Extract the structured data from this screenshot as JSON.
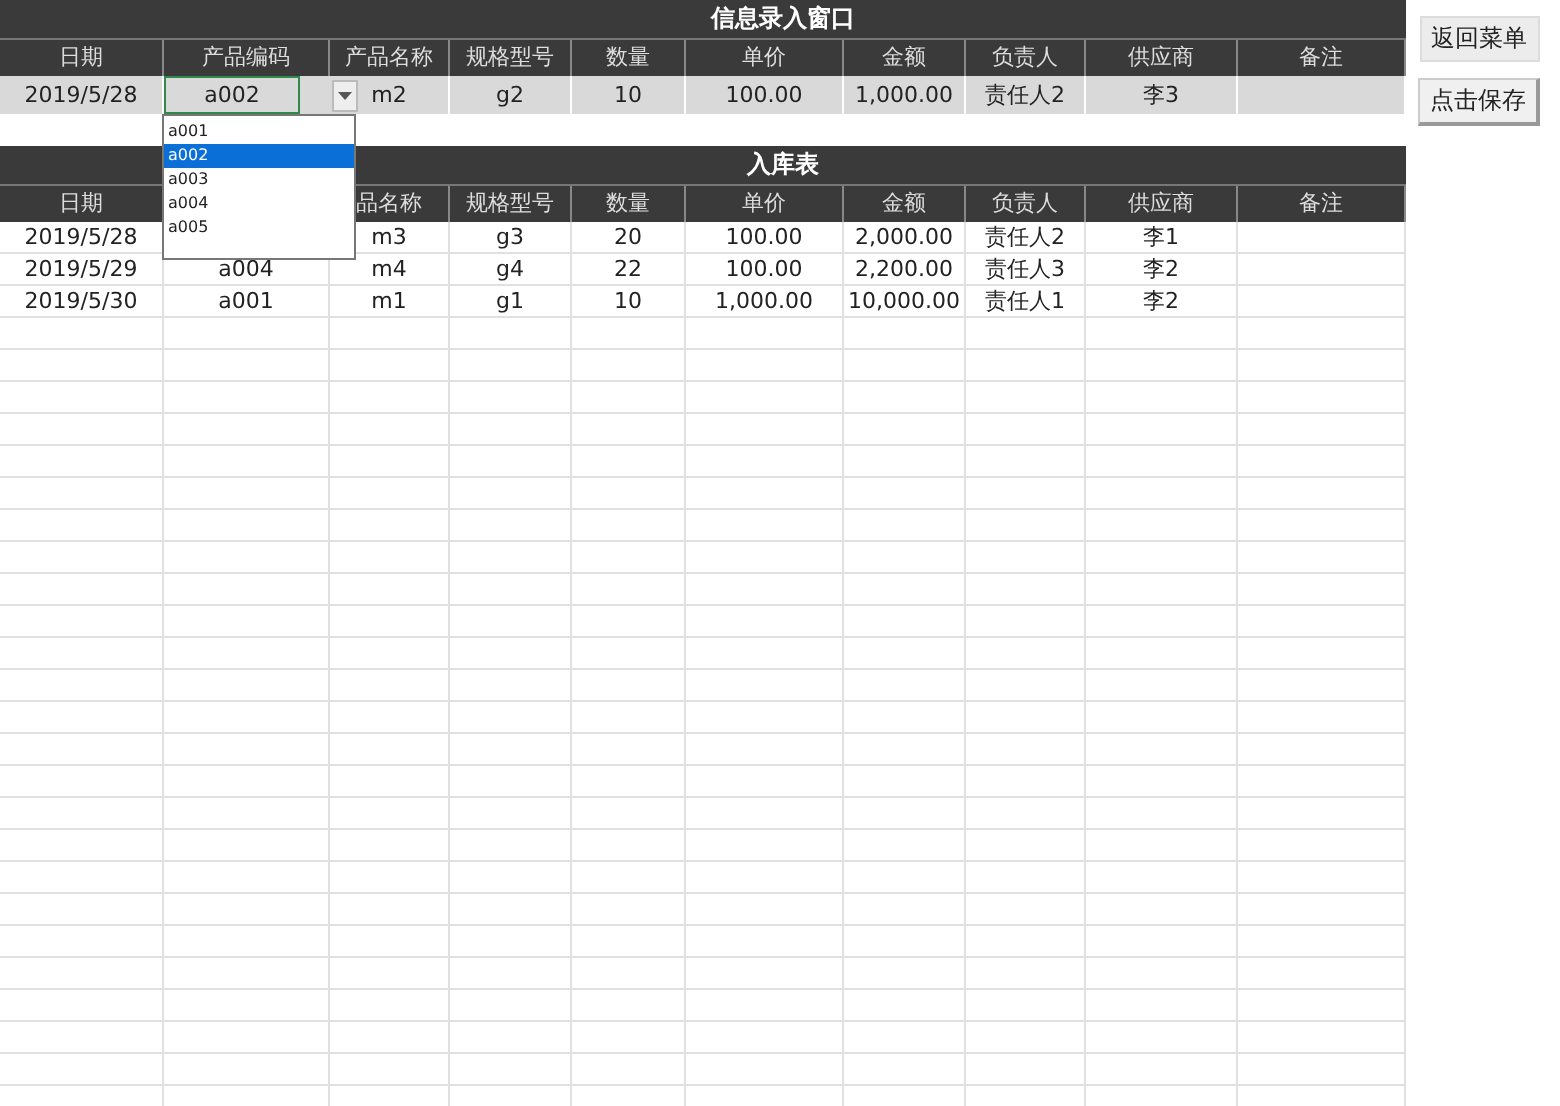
{
  "entry_form": {
    "title": "信息录入窗口",
    "columns": [
      "日期",
      "产品编码",
      "产品名称",
      "规格型号",
      "数量",
      "单价",
      "金额",
      "负责人",
      "供应商",
      "备注"
    ],
    "row": [
      "2019/5/28",
      "a002",
      "m2",
      "g2",
      "10",
      "100.00",
      "1,000.00",
      "责任人2",
      "李3"
    ],
    "code_dropdown": {
      "expanded": true,
      "options": [
        {
          "label": "a001",
          "selected": false
        },
        {
          "label": "a002",
          "selected": true
        },
        {
          "label": "a003",
          "selected": false
        },
        {
          "label": "a004",
          "selected": false
        },
        {
          "label": "a005",
          "selected": false
        }
      ]
    }
  },
  "stock_table": {
    "title": "入库表",
    "columns": [
      "日期",
      null,
      "品名称",
      "规格型号",
      "数量",
      "单价",
      "金额",
      "负责人",
      "供应商",
      "备注"
    ],
    "rows": [
      [
        "2019/5/28",
        null,
        "m3",
        "g3",
        "20",
        "100.00",
        "2,000.00",
        "责任人2",
        "李1"
      ],
      [
        "2019/5/29",
        "a004",
        "m4",
        "g4",
        "22",
        "100.00",
        "2,200.00",
        "责任人3",
        "李2"
      ],
      [
        "2019/5/30",
        "a001",
        "m1",
        "g1",
        "10",
        "1,000.00",
        "10,000.00",
        "责任人1",
        "李2"
      ]
    ]
  },
  "buttons": [
    "返回菜单",
    "点击保存"
  ]
}
